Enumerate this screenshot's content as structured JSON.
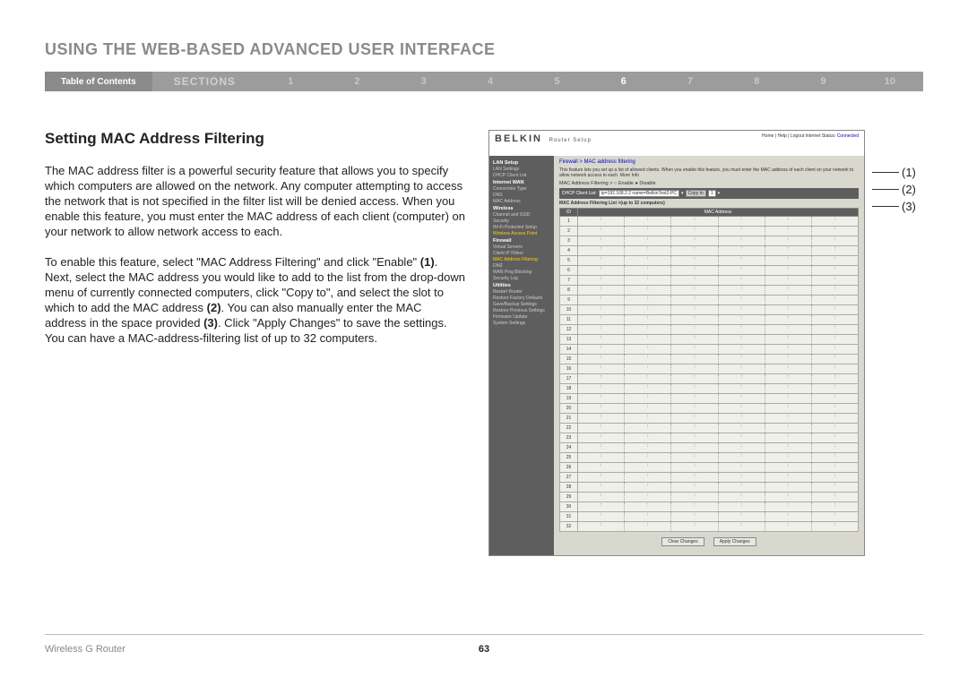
{
  "header": {
    "title": "USING THE WEB-BASED ADVANCED USER INTERFACE"
  },
  "nav": {
    "toc": "Table of Contents",
    "sections_label": "SECTIONS",
    "items": [
      "1",
      "2",
      "3",
      "4",
      "5",
      "6",
      "7",
      "8",
      "9",
      "10"
    ],
    "active_index": 5
  },
  "main": {
    "heading": "Setting MAC Address Filtering",
    "para1": "The MAC address filter is a powerful security feature that allows you to specify which computers are allowed on the network. Any computer attempting to access the network that is not specified in the filter list will be denied access. When you enable this feature, you must enter the MAC address of each client (computer) on your network to allow network access to each.",
    "para2_a": "To enable this feature, select \"MAC Address Filtering\" and click \"Enable\" ",
    "para2_b1": "(1)",
    "para2_c": ". Next, select the MAC address you would like to add to the list from the drop-down menu of currently connected computers, click \"Copy to\", and select the slot to which to add the MAC address ",
    "para2_b2": "(2)",
    "para2_d": ". You can also manually enter the MAC address in the space provided ",
    "para2_b3": "(3)",
    "para2_e": ". Click \"Apply Changes\" to save the settings. You can have a MAC-address-filtering list of up to 32 computers."
  },
  "screenshot": {
    "brand": "BELKIN",
    "brand_sub": "Router Setup",
    "top_links": "Home | Help | Logout   Internet Status:",
    "top_status": "Connected",
    "sidebar": [
      {
        "t": "LAN Setup",
        "cls": "head"
      },
      {
        "t": "LAN Settings",
        "cls": "item"
      },
      {
        "t": "DHCP Client List",
        "cls": "item"
      },
      {
        "t": "Internet WAN",
        "cls": "head"
      },
      {
        "t": "Connection Type",
        "cls": "item"
      },
      {
        "t": "DNS",
        "cls": "item"
      },
      {
        "t": "MAC Address",
        "cls": "item"
      },
      {
        "t": "Wireless",
        "cls": "head"
      },
      {
        "t": "Channel and SSID",
        "cls": "item"
      },
      {
        "t": "Security",
        "cls": "item"
      },
      {
        "t": "Wi-Fi Protected Setup",
        "cls": "item"
      },
      {
        "t": "Wireless Access Point",
        "cls": "item hl"
      },
      {
        "t": "Firewall",
        "cls": "head orange"
      },
      {
        "t": "Virtual Servers",
        "cls": "item"
      },
      {
        "t": "Client IP Filters",
        "cls": "item"
      },
      {
        "t": "MAC Address Filtering",
        "cls": "item hl"
      },
      {
        "t": "DMZ",
        "cls": "item"
      },
      {
        "t": "WAN Ping Blocking",
        "cls": "item"
      },
      {
        "t": "Security Log",
        "cls": "item"
      },
      {
        "t": "Utilities",
        "cls": "head"
      },
      {
        "t": "Restart Router",
        "cls": "item"
      },
      {
        "t": "Restore Factory Defaults",
        "cls": "item"
      },
      {
        "t": "Save/Backup Settings",
        "cls": "item"
      },
      {
        "t": "Restore Previous Settings",
        "cls": "item"
      },
      {
        "t": "Firmware Update",
        "cls": "item"
      },
      {
        "t": "System Settings",
        "cls": "item"
      }
    ],
    "breadcrumb": "Firewall > MAC address filtering",
    "desc": "This feature lets you set up a list of allowed clients. When you enable this feature, you must enter the MAC address of each client on your network to allow network access to each. More Info",
    "filter_label": "MAC Address Filtering >",
    "filter_enable": "Enable",
    "filter_disable": "Disable",
    "dhcp_label": "DHCP Client List:",
    "dhcp_value": "ip=192.168.2.2 name=BelkinTest2-PC",
    "dhcp_copy": "Copy to",
    "dhcp_slot": "1",
    "list_title": "MAC Address Filtering List >(up to 32 computers)",
    "th_id": "ID",
    "th_mac": "MAC Address",
    "row_count": 32,
    "btn_clear": "Clear Changes",
    "btn_apply": "Apply Changes"
  },
  "annotations": {
    "a1": "(1)",
    "a2": "(2)",
    "a3": "(3)"
  },
  "footer": {
    "product": "Wireless G Router",
    "page": "63"
  }
}
